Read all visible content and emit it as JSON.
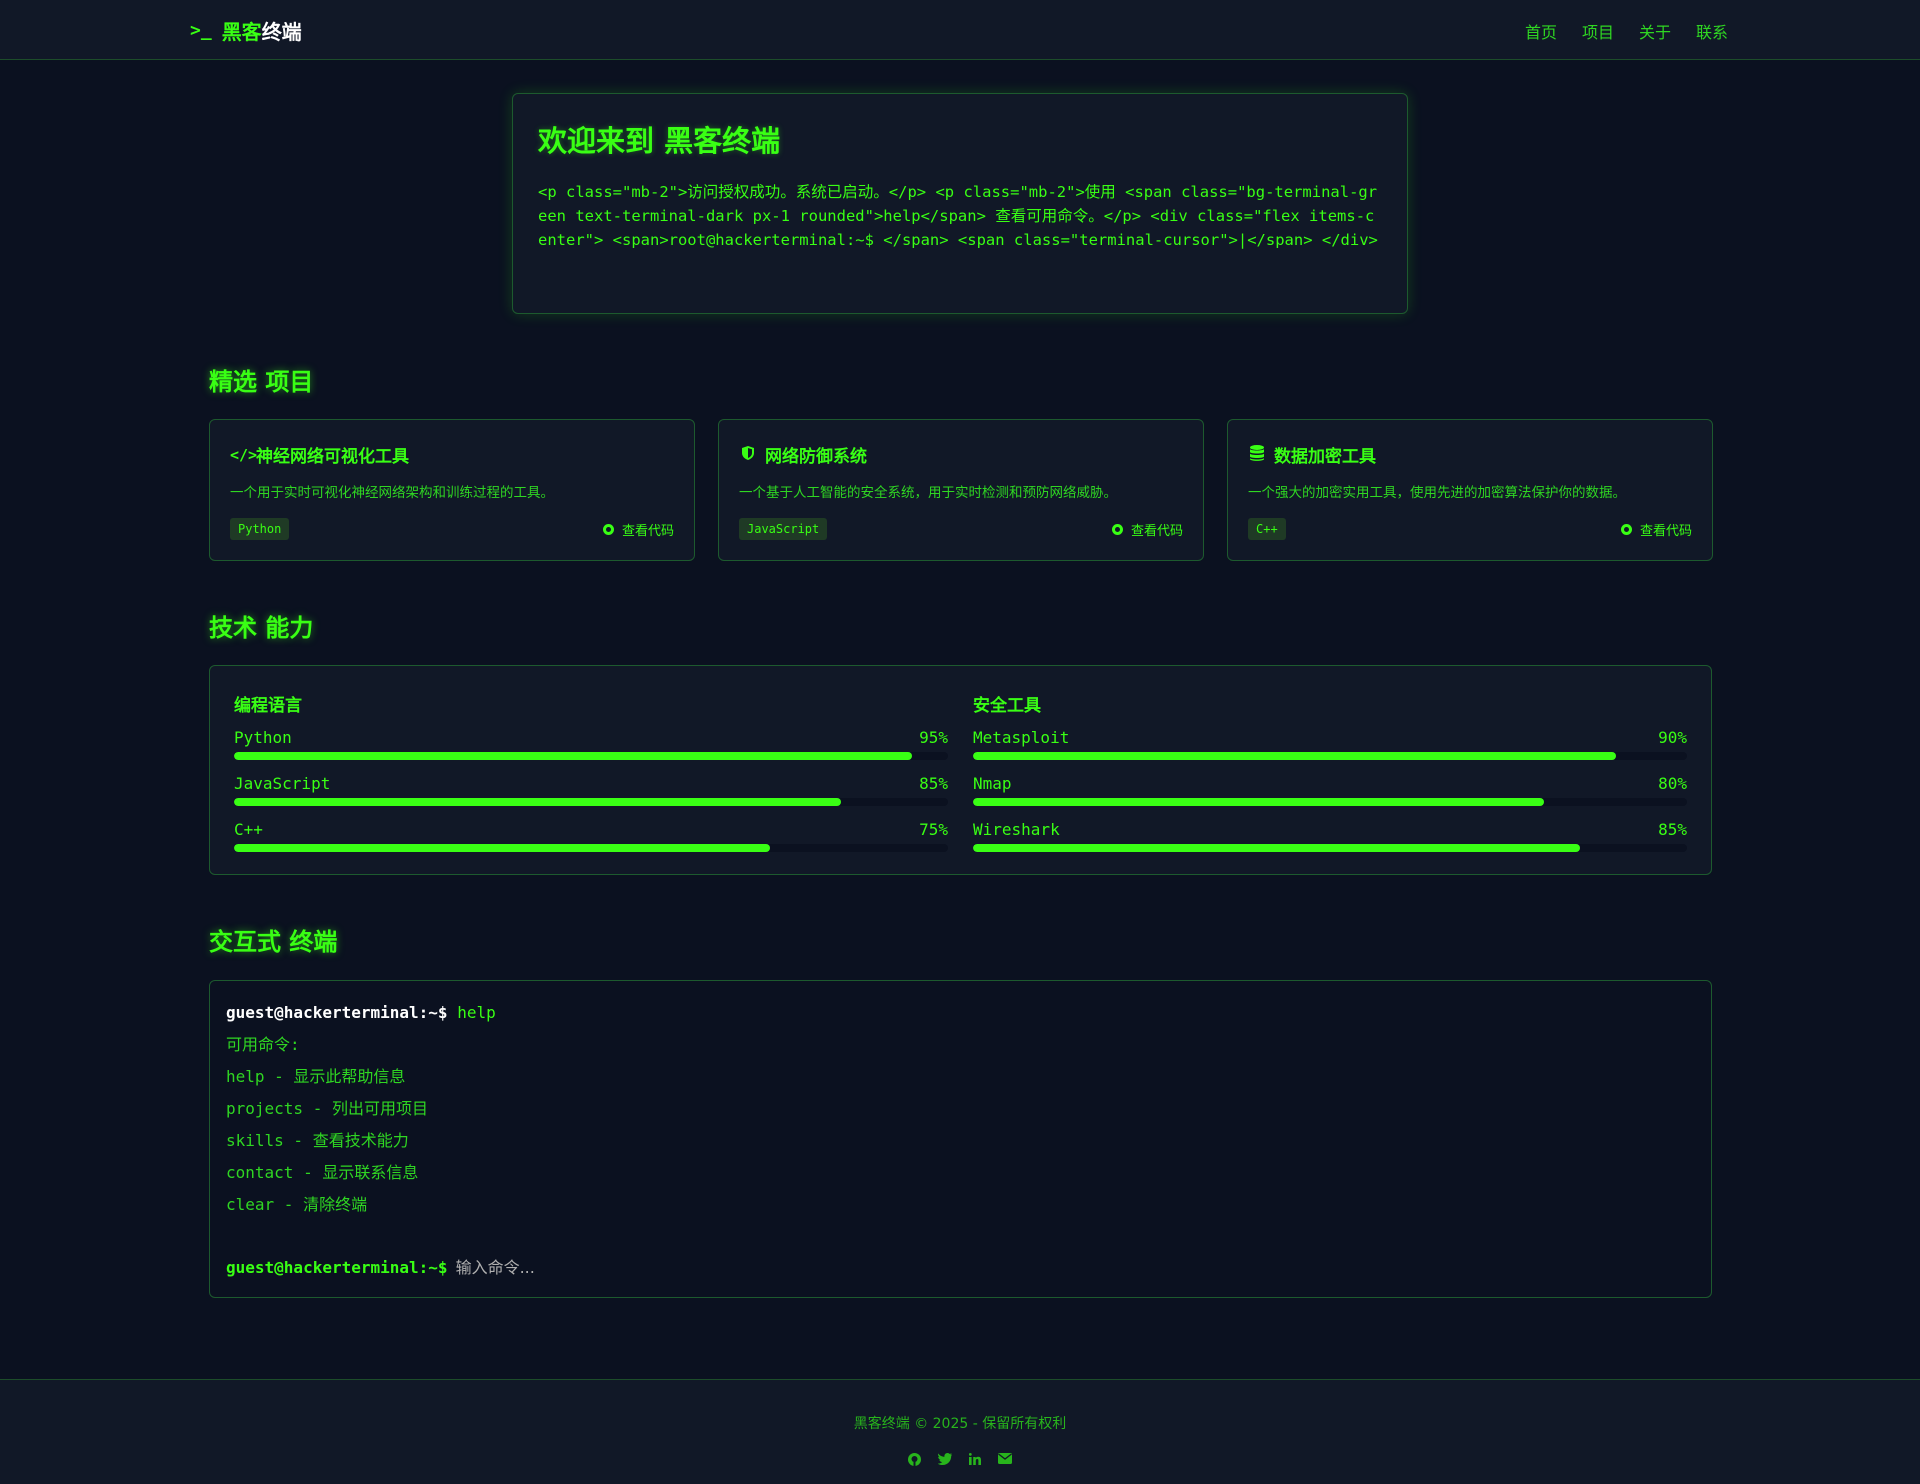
{
  "nav": {
    "brand_prompt": ">_",
    "brand_part1": "黑客",
    "brand_part2": "终端",
    "links": [
      "首页",
      "项目",
      "关于",
      "联系"
    ]
  },
  "welcome": {
    "title": "欢迎来到 黑客终端",
    "text": "<p class=\"mb-2\">访问授权成功。系统已启动。</p> <p class=\"mb-2\">使用 <span class=\"bg-terminal-green text-terminal-dark px-1 rounded\">help</span> 查看可用命令。</p> <div class=\"flex items-center\"> <span>root@hackerterminal:~$ </span> <span class=\"terminal-cursor\">|</span> </div>"
  },
  "sections": {
    "projects_title": "精选 项目",
    "skills_title": "技术 能力",
    "terminal_title": "交互式 终端"
  },
  "projects": [
    {
      "icon": "code-icon",
      "title": "神经网络可视化工具",
      "desc": "一个用于实时可视化神经网络架构和训练过程的工具。",
      "tag": "Python",
      "link": "查看代码"
    },
    {
      "icon": "shield-icon",
      "title": "网络防御系统",
      "desc": "一个基于人工智能的安全系统，用于实时检测和预防网络威胁。",
      "tag": "JavaScript",
      "link": "查看代码"
    },
    {
      "icon": "database-icon",
      "title": "数据加密工具",
      "desc": "一个强大的加密实用工具，使用先进的加密算法保护你的数据。",
      "tag": "C++",
      "link": "查看代码"
    }
  ],
  "skills": {
    "languages": {
      "title": "编程语言",
      "items": [
        {
          "name": "Python",
          "pct": "95%",
          "value": 95
        },
        {
          "name": "JavaScript",
          "pct": "85%",
          "value": 85
        },
        {
          "name": "C++",
          "pct": "75%",
          "value": 75
        }
      ]
    },
    "tools": {
      "title": "安全工具",
      "items": [
        {
          "name": "Metasploit",
          "pct": "90%",
          "value": 90
        },
        {
          "name": "Nmap",
          "pct": "80%",
          "value": 80
        },
        {
          "name": "Wireshark",
          "pct": "85%",
          "value": 85
        }
      ]
    }
  },
  "terminal": {
    "prompt": "guest@hackerterminal:~$",
    "command": "help",
    "lines": [
      "可用命令:",
      "help - 显示此帮助信息",
      "projects - 列出可用项目",
      "skills - 查看技术能力",
      "contact - 显示联系信息",
      "clear - 清除终端"
    ],
    "input_placeholder": "输入命令..."
  },
  "footer": {
    "copyright": "黑客终端 © 2025 - 保留所有权利",
    "social_icons": [
      "github-icon",
      "twitter-icon",
      "linkedin-icon",
      "email-icon"
    ]
  },
  "colors": {
    "accent": "#39ff14",
    "background": "#0b1120",
    "panel": "#111827",
    "border": "#1d5a2e"
  }
}
